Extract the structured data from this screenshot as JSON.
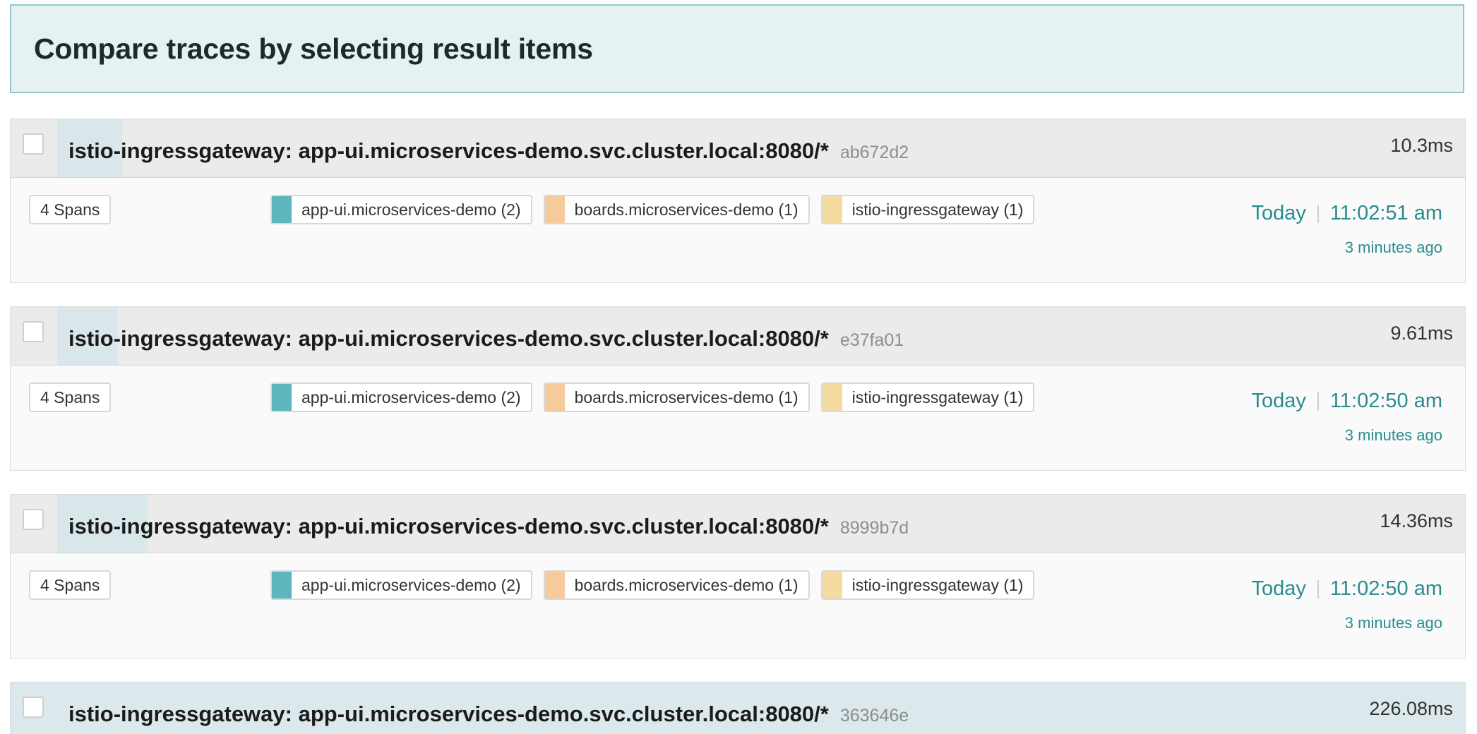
{
  "banner": {
    "title": "Compare traces by selecting result items"
  },
  "colors": {
    "app_ui": "#5db5be",
    "boards": "#f6ca9c",
    "istio": "#f5dba2",
    "accent": "#2a8c8f"
  },
  "traces": [
    {
      "name": "istio-ingressgateway: app-ui.microservices-demo.svc.cluster.local:8080/*",
      "trace_id": "ab672d2",
      "duration": "10.3ms",
      "spans": "4 Spans",
      "services": [
        {
          "label": "app-ui.microservices-demo (2)",
          "color": "#5db5be"
        },
        {
          "label": "boards.microservices-demo (1)",
          "color": "#f6ca9c"
        },
        {
          "label": "istio-ingressgateway (1)",
          "color": "#f5dba2"
        }
      ],
      "day": "Today",
      "time": "11:02:51 am",
      "relative": "3 minutes ago"
    },
    {
      "name": "istio-ingressgateway: app-ui.microservices-demo.svc.cluster.local:8080/*",
      "trace_id": "e37fa01",
      "duration": "9.61ms",
      "spans": "4 Spans",
      "services": [
        {
          "label": "app-ui.microservices-demo (2)",
          "color": "#5db5be"
        },
        {
          "label": "boards.microservices-demo (1)",
          "color": "#f6ca9c"
        },
        {
          "label": "istio-ingressgateway (1)",
          "color": "#f5dba2"
        }
      ],
      "day": "Today",
      "time": "11:02:50 am",
      "relative": "3 minutes ago"
    },
    {
      "name": "istio-ingressgateway: app-ui.microservices-demo.svc.cluster.local:8080/*",
      "trace_id": "8999b7d",
      "duration": "14.36ms",
      "spans": "4 Spans",
      "services": [
        {
          "label": "app-ui.microservices-demo (2)",
          "color": "#5db5be"
        },
        {
          "label": "boards.microservices-demo (1)",
          "color": "#f6ca9c"
        },
        {
          "label": "istio-ingressgateway (1)",
          "color": "#f5dba2"
        }
      ],
      "day": "Today",
      "time": "11:02:50 am",
      "relative": "3 minutes ago"
    },
    {
      "name": "istio-ingressgateway: app-ui.microservices-demo.svc.cluster.local:8080/*",
      "trace_id": "363646e",
      "duration": "226.08ms"
    }
  ]
}
